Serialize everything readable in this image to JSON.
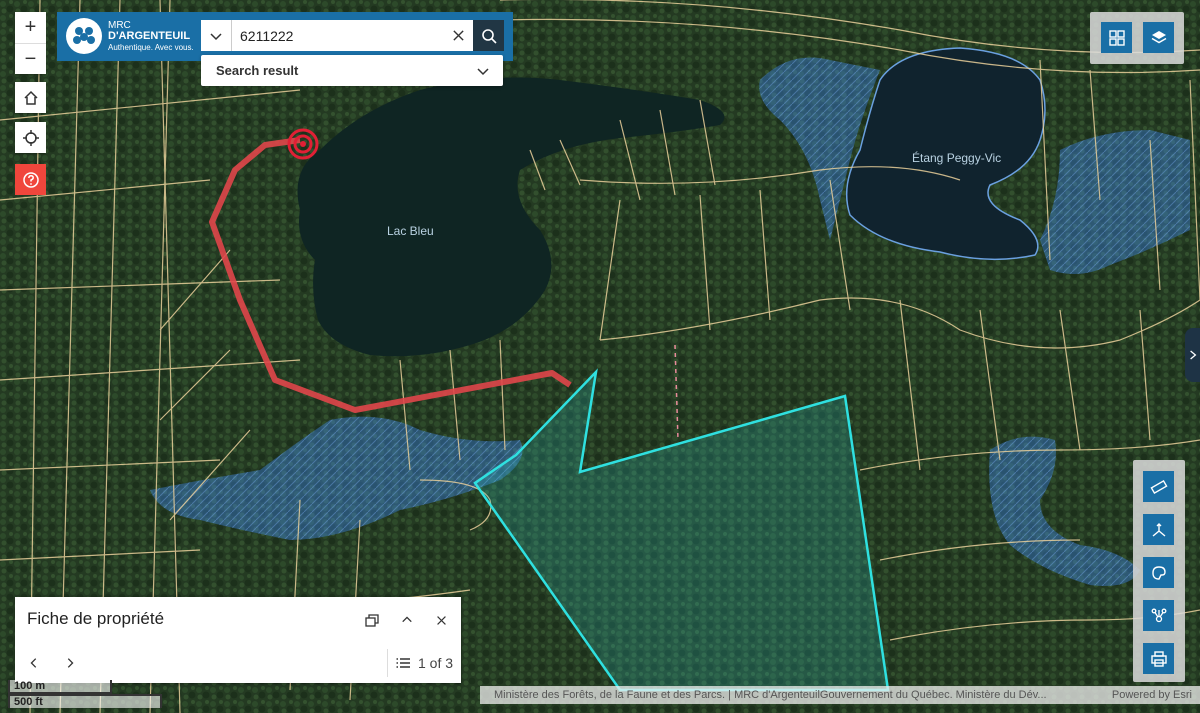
{
  "search": {
    "value": "6211222",
    "results_label": "Search result"
  },
  "brand": {
    "line1": "MRC",
    "line2": "D'ARGENTEUIL",
    "line3": "Authentique. Avec vous."
  },
  "map_labels": {
    "lake1": "Lac Bleu",
    "lake2": "Étang Peggy-Vic"
  },
  "controls": {
    "zoom_in": "+",
    "zoom_out": "−"
  },
  "panel": {
    "title": "Fiche de propriété",
    "pager": "1 of 3"
  },
  "scale": {
    "metric": "100 m",
    "imperial": "500 ft"
  },
  "attribution": {
    "text": "Ministère des Forêts, de la Faune et des Parcs. | MRC d'ArgenteuilGouvernement du Québec. Ministère du Dév...",
    "powered": "Powered by Esri"
  },
  "colors": {
    "brand": "#1a6fa6",
    "route": "#e0464a",
    "parcel_highlight": "#2fe0e0",
    "lot_lines": "#e9cf9a",
    "wetland": "#3a7fd6"
  }
}
